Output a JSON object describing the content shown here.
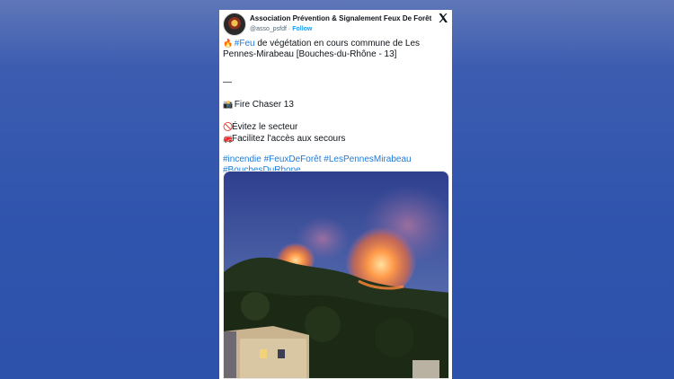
{
  "tweet": {
    "display_name": "Association Prévention & Signalement Feux De Forêt",
    "handle": "@asso_psfdf",
    "separator": "·",
    "follow_label": "Follow",
    "lines": {
      "l1_hashtag": "#Feu",
      "l1_text": " de végétation en cours commune de Les Pennes-Mirabeau [Bouches-du-Rhône - 13]",
      "dash": "—",
      "camera_text": "Fire Chaser 13",
      "avoid_text": "Évitez le secteur",
      "access_text": "Facilitez l'accès aux secours"
    },
    "hashtags": [
      "#incendie",
      "#FeuxDeForêt",
      "#LesPennesMirabeau",
      "#BouchesDuRhone"
    ],
    "icons": {
      "fire": "fire-emoji",
      "camera": "camera-emoji",
      "no_entry": "no-entry-emoji",
      "fire_engine": "fire-engine-emoji",
      "x_logo": "x-logo-icon"
    }
  },
  "colors": {
    "background": "#2f54ad",
    "link": "#1d7bd8",
    "follow": "#1d9bf0"
  }
}
